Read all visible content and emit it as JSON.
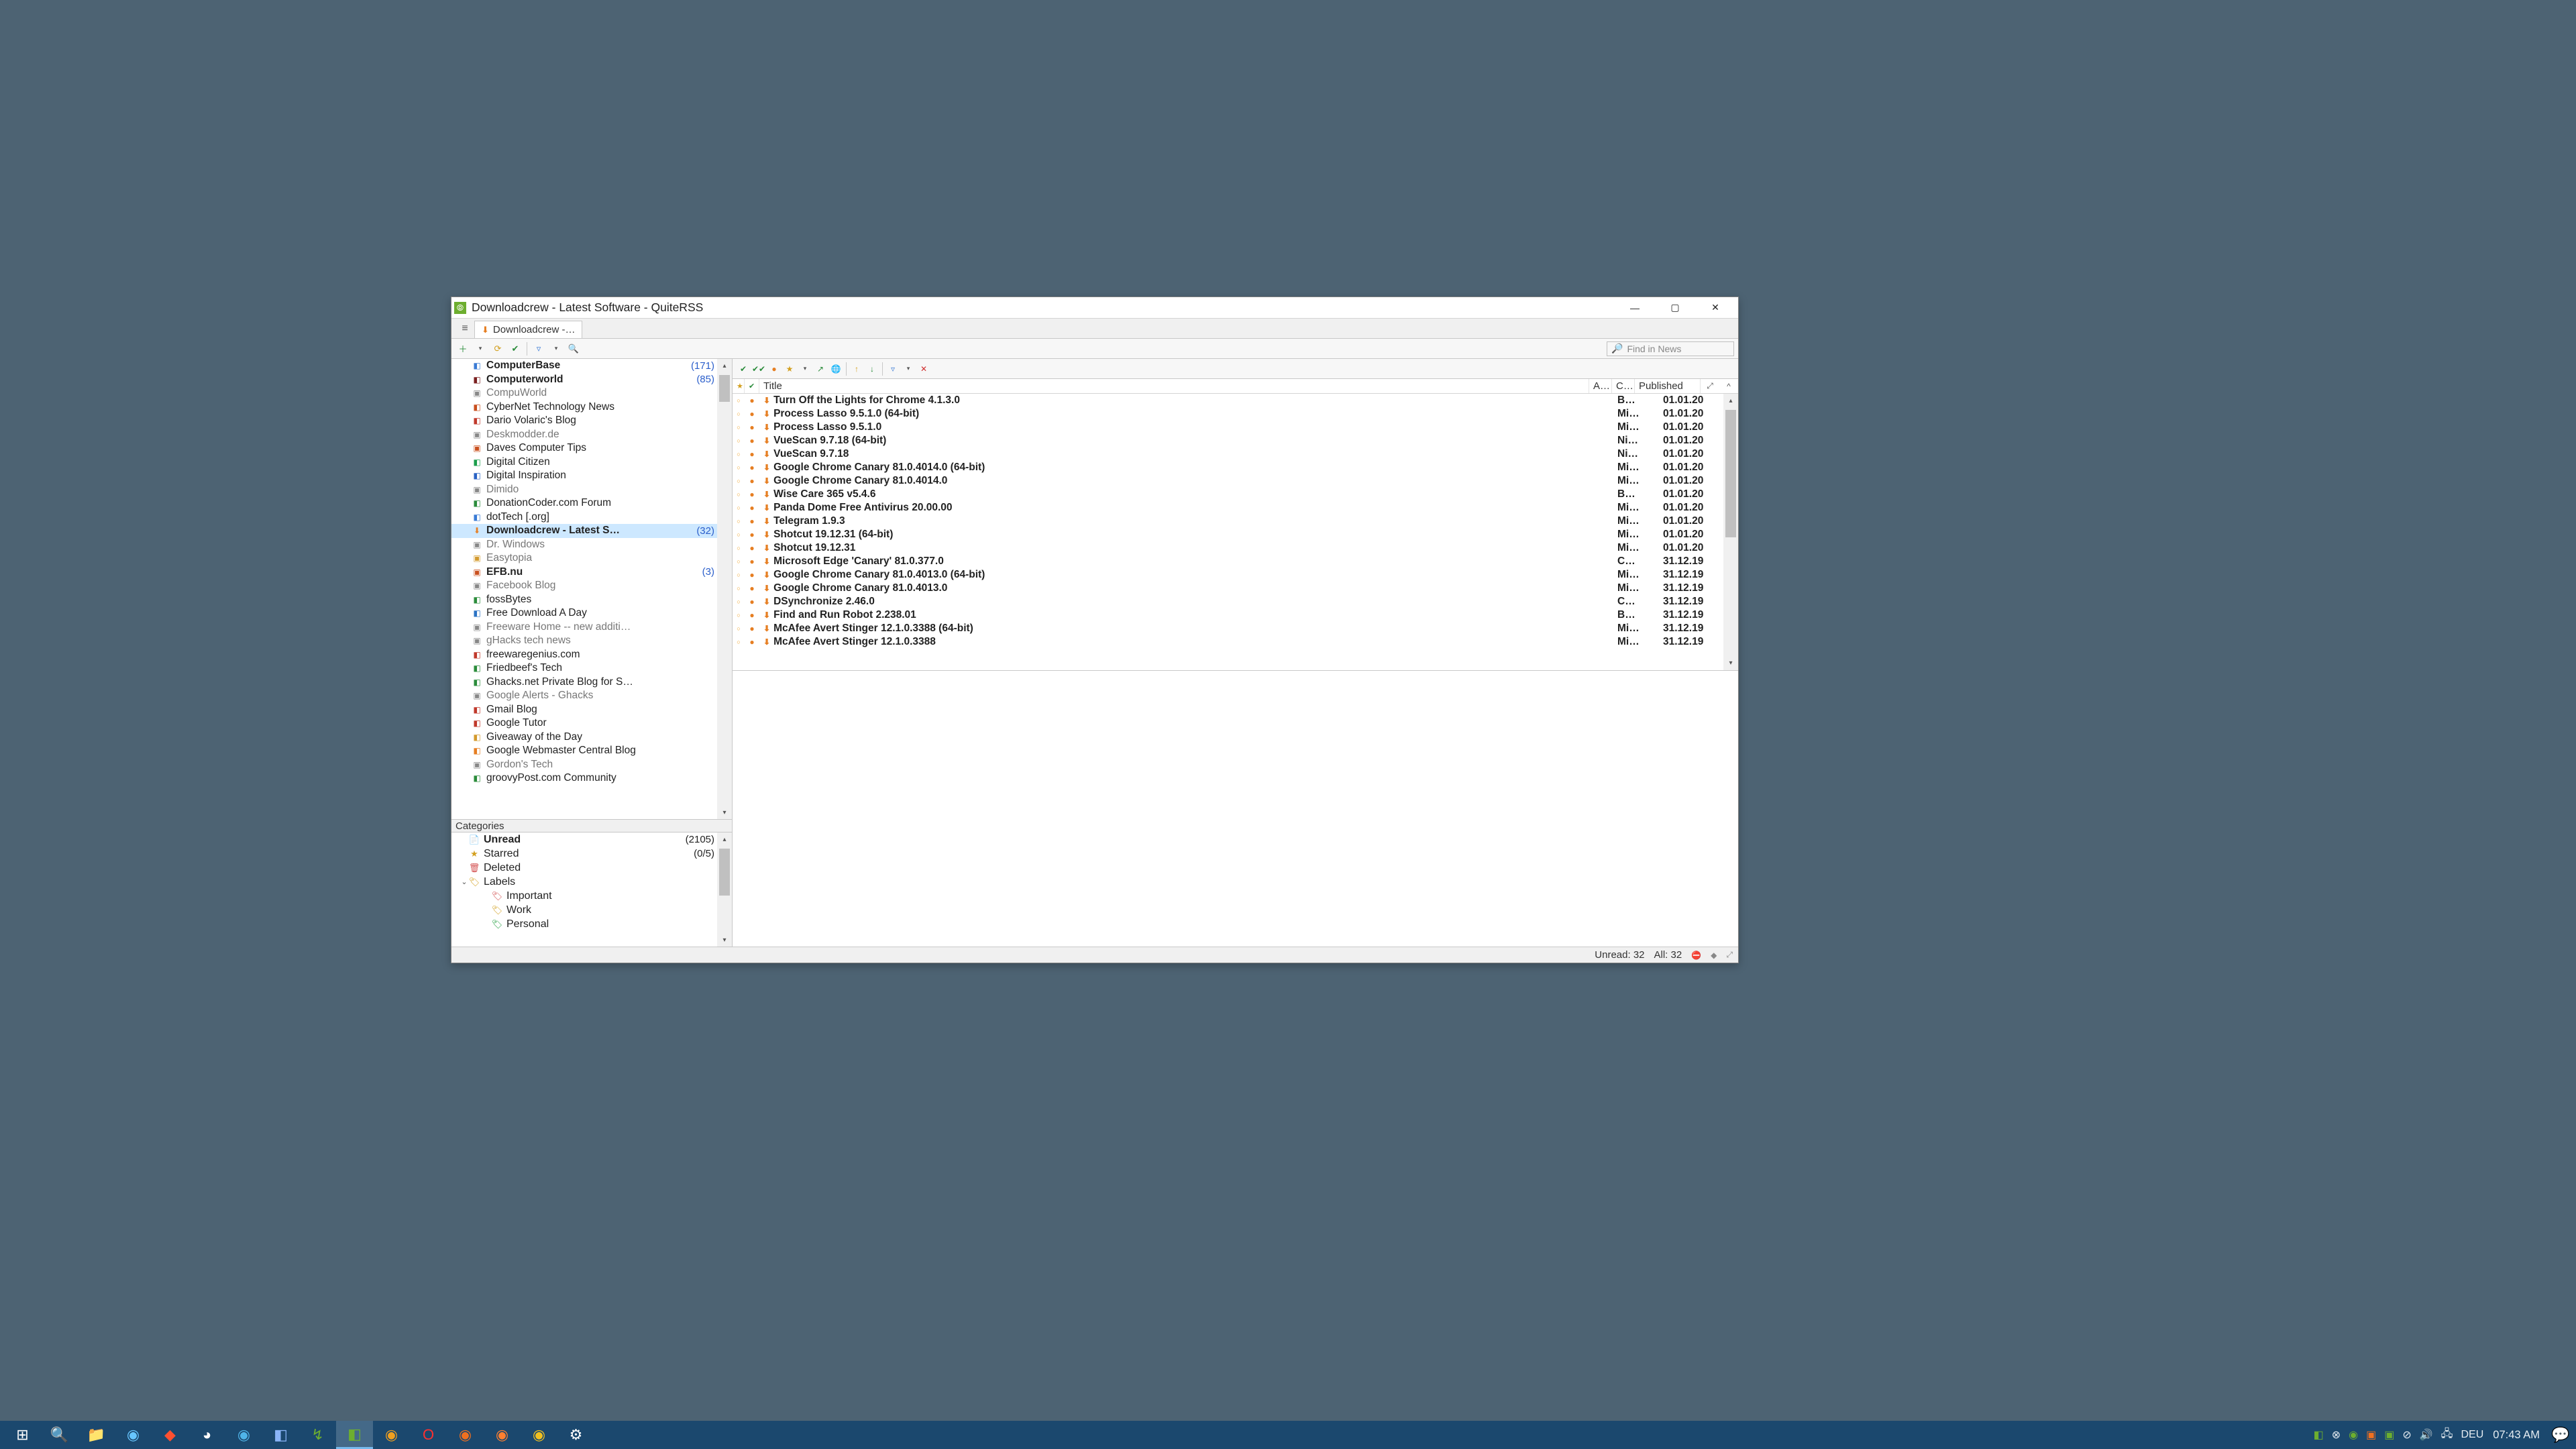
{
  "window": {
    "title": "Downloadcrew - Latest Software - QuiteRSS",
    "tab_label": "Downloadcrew -…"
  },
  "toolbar": {
    "search_placeholder": "Find in News"
  },
  "feeds": [
    {
      "name": "ComputerBase",
      "count": "(171)",
      "bold": true,
      "icon": "◧",
      "iconColor": "#3a7bd5"
    },
    {
      "name": "Computerworld",
      "count": "(85)",
      "bold": true,
      "icon": "◧",
      "iconColor": "#7a1f1f"
    },
    {
      "name": "CompuWorld",
      "icon": "▣",
      "iconColor": "#888",
      "dim": true
    },
    {
      "name": "CyberNet Technology News",
      "icon": "◧",
      "iconColor": "#c94f1d"
    },
    {
      "name": "Dario Volaric's Blog",
      "icon": "◧",
      "iconColor": "#c0392b"
    },
    {
      "name": "Deskmodder.de",
      "icon": "▣",
      "iconColor": "#888",
      "dim": true
    },
    {
      "name": "Daves Computer Tips",
      "icon": "▣",
      "iconColor": "#c94f1d"
    },
    {
      "name": "Digital Citizen",
      "icon": "◧",
      "iconColor": "#1b9e4b"
    },
    {
      "name": "Digital Inspiration",
      "icon": "◧",
      "iconColor": "#2962c4"
    },
    {
      "name": "Dimido",
      "icon": "▣",
      "iconColor": "#888",
      "dim": true
    },
    {
      "name": "DonationCoder.com Forum",
      "icon": "◧",
      "iconColor": "#2b8c3b"
    },
    {
      "name": "dotTech [.org]",
      "icon": "◧",
      "iconColor": "#3a7bd5"
    },
    {
      "name": "Downloadcrew - Latest S…",
      "count": "(32)",
      "bold": true,
      "sel": true,
      "icon": "⬇",
      "iconColor": "#e67e22"
    },
    {
      "name": "Dr. Windows",
      "icon": "▣",
      "iconColor": "#888",
      "dim": true
    },
    {
      "name": "Easytopia",
      "icon": "▣",
      "iconColor": "#d39a2d",
      "dim": true
    },
    {
      "name": "EFB.nu",
      "count": "(3)",
      "bold": true,
      "icon": "▣",
      "iconColor": "#c94f1d"
    },
    {
      "name": "Facebook Blog",
      "icon": "▣",
      "iconColor": "#888",
      "dim": true
    },
    {
      "name": "fossBytes",
      "icon": "◧",
      "iconColor": "#2b8c3b"
    },
    {
      "name": "Free Download A Day",
      "icon": "◧",
      "iconColor": "#2b73c4"
    },
    {
      "name": "Freeware Home -- new additi…",
      "icon": "▣",
      "iconColor": "#888",
      "dim": true
    },
    {
      "name": "gHacks tech news",
      "icon": "▣",
      "iconColor": "#888",
      "dim": true
    },
    {
      "name": "freewaregenius.com",
      "icon": "◧",
      "iconColor": "#c0392b"
    },
    {
      "name": "Friedbeef's Tech",
      "icon": "◧",
      "iconColor": "#2b8c3b"
    },
    {
      "name": "Ghacks.net Private Blog for S…",
      "icon": "◧",
      "iconColor": "#2b8c3b"
    },
    {
      "name": "Google Alerts - Ghacks",
      "icon": "▣",
      "iconColor": "#888",
      "dim": true
    },
    {
      "name": "Gmail Blog",
      "icon": "◧",
      "iconColor": "#c0392b"
    },
    {
      "name": "Google Tutor",
      "icon": "◧",
      "iconColor": "#c0392b"
    },
    {
      "name": "Giveaway of the Day",
      "icon": "◧",
      "iconColor": "#d39a2d"
    },
    {
      "name": "Google Webmaster Central Blog",
      "icon": "◧",
      "iconColor": "#e67e22"
    },
    {
      "name": "Gordon's Tech",
      "icon": "▣",
      "iconColor": "#888",
      "dim": true
    },
    {
      "name": "groovyPost.com Community",
      "icon": "◧",
      "iconColor": "#2b8c3b"
    }
  ],
  "categories_label": "Categories",
  "categories": [
    {
      "name": "Unread",
      "count": "(2105)",
      "bold": true,
      "icon": "📄",
      "iconColor": "#d39a2d"
    },
    {
      "name": "Starred",
      "count": "(0/5)",
      "icon": "★",
      "iconColor": "#d3a020"
    },
    {
      "name": "Deleted",
      "icon": "🗑",
      "iconColor": "#d35050"
    },
    {
      "name": "Labels",
      "icon": "🏷",
      "iconColor": "#d3a020",
      "caret": true
    },
    {
      "name": "Important",
      "sub": true,
      "icon": "🏷",
      "iconColor": "#d35050"
    },
    {
      "name": "Work",
      "sub": true,
      "icon": "🏷",
      "iconColor": "#d3a020"
    },
    {
      "name": "Personal",
      "sub": true,
      "icon": "🏷",
      "iconColor": "#23a040"
    }
  ],
  "list_headers": {
    "star": "",
    "read": "",
    "title": "Title",
    "author": "A…",
    "c": "C…",
    "published": "Published"
  },
  "news": [
    {
      "title": "Turn Off the Lights for Chrome 4.1.3.0",
      "a": "B…",
      "pub": "01.01.20"
    },
    {
      "title": "Process Lasso 9.5.1.0 (64-bit)",
      "a": "Mi…",
      "pub": "01.01.20"
    },
    {
      "title": "Process Lasso 9.5.1.0",
      "a": "Mi…",
      "pub": "01.01.20"
    },
    {
      "title": "VueScan 9.7.18 (64-bit)",
      "a": "Ni…",
      "pub": "01.01.20"
    },
    {
      "title": "VueScan 9.7.18",
      "a": "Ni…",
      "pub": "01.01.20"
    },
    {
      "title": "Google Chrome Canary 81.0.4014.0 (64-bit)",
      "a": "Mi…",
      "pub": "01.01.20"
    },
    {
      "title": "Google Chrome Canary 81.0.4014.0",
      "a": "Mi…",
      "pub": "01.01.20"
    },
    {
      "title": "Wise Care 365 v5.4.6",
      "a": "B…",
      "pub": "01.01.20"
    },
    {
      "title": "Panda Dome Free Antivirus 20.00.00",
      "a": "Mi…",
      "pub": "01.01.20"
    },
    {
      "title": "Telegram 1.9.3",
      "a": "Mi…",
      "pub": "01.01.20"
    },
    {
      "title": "Shotcut 19.12.31 (64-bit)",
      "a": "Mi…",
      "pub": "01.01.20"
    },
    {
      "title": "Shotcut 19.12.31",
      "a": "Mi…",
      "pub": "01.01.20"
    },
    {
      "title": "Microsoft Edge 'Canary' 81.0.377.0",
      "a": "C…",
      "pub": "31.12.19"
    },
    {
      "title": "Google Chrome Canary 81.0.4013.0 (64-bit)",
      "a": "Mi…",
      "pub": "31.12.19"
    },
    {
      "title": "Google Chrome Canary 81.0.4013.0",
      "a": "Mi…",
      "pub": "31.12.19"
    },
    {
      "title": "DSynchronize 2.46.0",
      "a": "C…",
      "pub": "31.12.19"
    },
    {
      "title": "Find and Run Robot 2.238.01",
      "a": "B…",
      "pub": "31.12.19"
    },
    {
      "title": "McAfee Avert Stinger 12.1.0.3388 (64-bit)",
      "a": "Mi…",
      "pub": "31.12.19"
    },
    {
      "title": "McAfee Avert Stinger 12.1.0.3388",
      "a": "Mi…",
      "pub": "31.12.19"
    }
  ],
  "status": {
    "unread": "Unread: 32",
    "all": "All: 32"
  },
  "taskbar": {
    "lang": "DEU",
    "time": "07:43 AM"
  }
}
